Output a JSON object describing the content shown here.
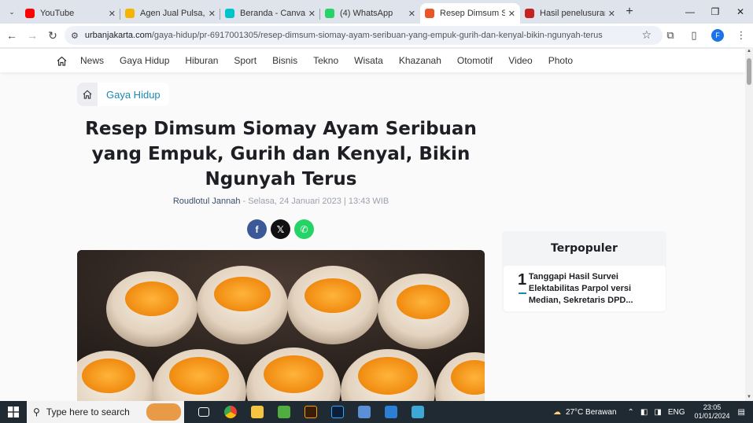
{
  "tabs": [
    {
      "title": "YouTube",
      "color": "#ff0000",
      "active": false
    },
    {
      "title": "Agen Jual Pulsa, PPOB",
      "color": "#f4b400",
      "active": false
    },
    {
      "title": "Beranda - Canva",
      "color": "#00c4cc",
      "active": false
    },
    {
      "title": "(4) WhatsApp",
      "color": "#25d366",
      "active": false
    },
    {
      "title": "Resep Dimsum Siomay",
      "color": "#e8562a",
      "active": true
    },
    {
      "title": "Hasil penelusuran - urb",
      "color": "#c5221f",
      "active": false
    }
  ],
  "address": {
    "domain": "urbanjakarta.com",
    "path": "/gaya-hidup/pr-6917001305/resep-dimsum-siomay-ayam-seribuan-yang-empuk-gurih-dan-kenyal-bikin-ngunyah-terus"
  },
  "profile_initial": "F",
  "nav": [
    "News",
    "Gaya Hidup",
    "Hiburan",
    "Sport",
    "Bisnis",
    "Tekno",
    "Wisata",
    "Khazanah",
    "Otomotif",
    "Video",
    "Photo"
  ],
  "breadcrumb": "Gaya Hidup",
  "article": {
    "title": "Resep Dimsum Siomay Ayam Seribuan yang Empuk, Gurih dan Kenyal, Bikin Ngunyah Terus",
    "author": "Roudlotul Jannah",
    "date": " - Selasa, 24 Januari 2023 | 13:43 WIB"
  },
  "share": [
    {
      "icon": "facebook-icon",
      "glyph": "f",
      "color": "#3b5998"
    },
    {
      "icon": "x-icon",
      "glyph": "𝕏",
      "color": "#111111"
    },
    {
      "icon": "whatsapp-icon",
      "glyph": "✆",
      "color": "#25d366"
    }
  ],
  "sidebar": {
    "title": "Terpopuler",
    "items": [
      {
        "rank": "1",
        "text": "Tanggapi Hasil Survei Elektabilitas Parpol versi Median, Sekretaris DPD..."
      }
    ]
  },
  "taskbar": {
    "search_placeholder": "Type here to search",
    "weather": "27°C  Berawan",
    "lang": "ENG",
    "time": "23:05",
    "date": "01/01/2024"
  },
  "colors": {
    "accent": "#1a8ab2",
    "taskbar": "#1f2a33"
  }
}
